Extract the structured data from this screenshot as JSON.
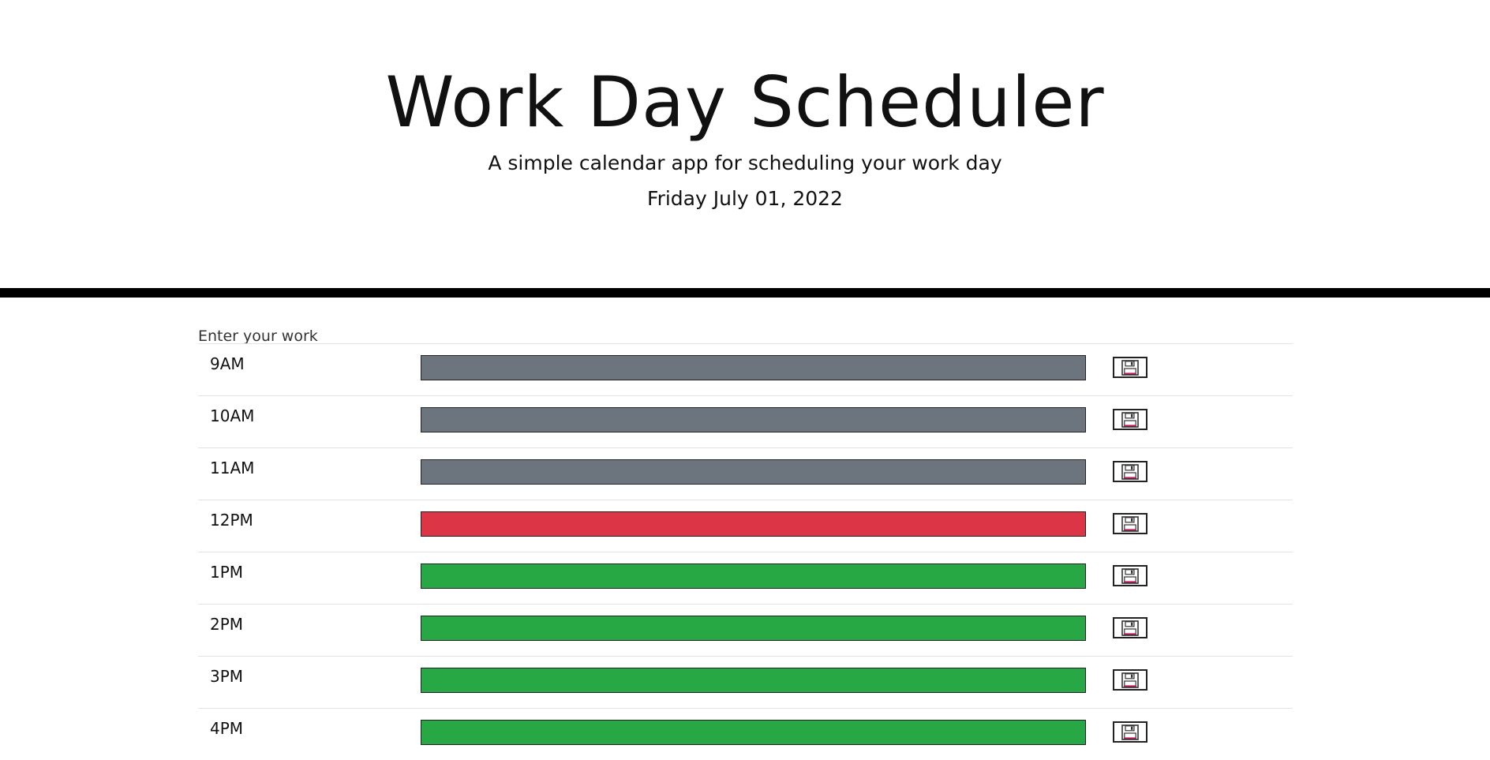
{
  "header": {
    "title": "Work Day Scheduler",
    "subtitle": "A simple calendar app for scheduling your work day",
    "date": "Friday July 01, 2022"
  },
  "main": {
    "section_label": "Enter your work",
    "rows": [
      {
        "hour": "9AM",
        "status": "past",
        "task": ""
      },
      {
        "hour": "10AM",
        "status": "past",
        "task": ""
      },
      {
        "hour": "11AM",
        "status": "past",
        "task": ""
      },
      {
        "hour": "12PM",
        "status": "present",
        "task": ""
      },
      {
        "hour": "1PM",
        "status": "future",
        "task": ""
      },
      {
        "hour": "2PM",
        "status": "future",
        "task": ""
      },
      {
        "hour": "3PM",
        "status": "future",
        "task": ""
      },
      {
        "hour": "4PM",
        "status": "future",
        "task": ""
      }
    ]
  },
  "colors": {
    "past": "#6c757d",
    "present": "#dc3545",
    "future": "#28a745"
  },
  "icons": {
    "save": "floppy-disk-icon"
  }
}
